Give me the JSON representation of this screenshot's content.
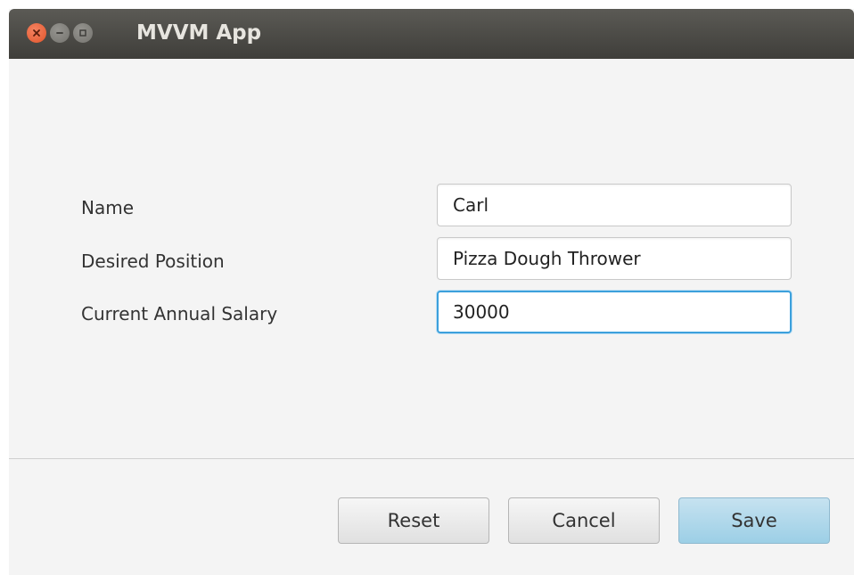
{
  "window": {
    "title": "MVVM App"
  },
  "titlebar_controls": [
    "close-icon",
    "minimize-icon",
    "maximize-icon"
  ],
  "form": {
    "name": {
      "label": "Name",
      "value": "Carl"
    },
    "position": {
      "label": "Desired Position",
      "value": "Pizza Dough Thrower"
    },
    "salary": {
      "label": "Current Annual Salary",
      "value": "30000"
    }
  },
  "buttons": {
    "reset": "Reset",
    "cancel": "Cancel",
    "save": "Save"
  },
  "colors": {
    "close_button": "#e2552b",
    "focus_ring": "#3ca0dc",
    "default_button": "#a9d5ea"
  }
}
